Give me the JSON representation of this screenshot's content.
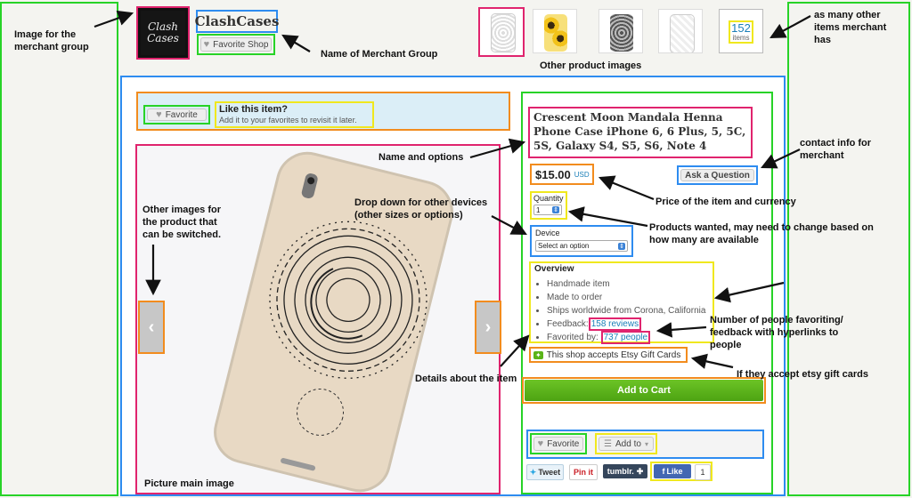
{
  "shop": {
    "logo_text": "Clash Cases",
    "name": "ClashCases",
    "favorite_shop_label": "Favorite Shop"
  },
  "thumbnails": {
    "count": "152",
    "count_label": "items"
  },
  "favorite_banner": {
    "favorite_label": "Favorite",
    "title": "Like this item?",
    "subtitle": "Add it to your favorites to revisit it later."
  },
  "product": {
    "title": "Crescent Moon Mandala Henna Phone Case iPhone 6, 6 Plus, 5, 5C, 5S, Galaxy S4, S5, S6, Note 4",
    "price": "$15.00",
    "currency": "USD",
    "ask_label": "Ask a Question",
    "quantity_label": "Quantity",
    "quantity_value": "1",
    "device_label": "Device",
    "device_placeholder": "Select an option",
    "overview_title": "Overview",
    "overview_items": [
      "Handmade item",
      "Made to order",
      "Ships worldwide from Corona, California"
    ],
    "feedback_label": "Feedback:",
    "feedback_link": "158 reviews",
    "favorited_label": "Favorited by:",
    "favorited_link": "737 people",
    "gift_cards": "This shop accepts Etsy Gift Cards",
    "add_to_cart": "Add to Cart",
    "favorite_label": "Favorite",
    "add_to_label": "Add to"
  },
  "social": {
    "tweet": "Tweet",
    "pinit": "Pin it",
    "tumblr": "tumblr.",
    "like": "Like",
    "like_count": "1"
  },
  "annotations": {
    "merchant_image": "Image for the merchant group",
    "merchant_name": "Name of Merchant Group",
    "other_images": "Other product images",
    "other_items": "as many other items merchant has",
    "name_options": "Name and options",
    "contact": "contact info for merchant",
    "price": "Price of the item and currency",
    "dropdown": "Drop down for other devices (other sizes or options)",
    "products_wanted": "Products wanted, may need to change based on how many are available",
    "switch_images": "Other images for the product that can be switched.",
    "num_favoriting": "Number of people favoriting/ feedback with hyperlinks to people",
    "details": "Details about the item",
    "gift_cards": "If they accept etsy gift cards",
    "main_image": "Picture main image"
  },
  "colors": {
    "green": "#27d327",
    "blue": "#2e8cf0",
    "pink": "#e0246e",
    "orange": "#f28c1e",
    "yellow": "#f0e81e",
    "cart_green": "#5ab418",
    "link": "#1a7fb8"
  }
}
